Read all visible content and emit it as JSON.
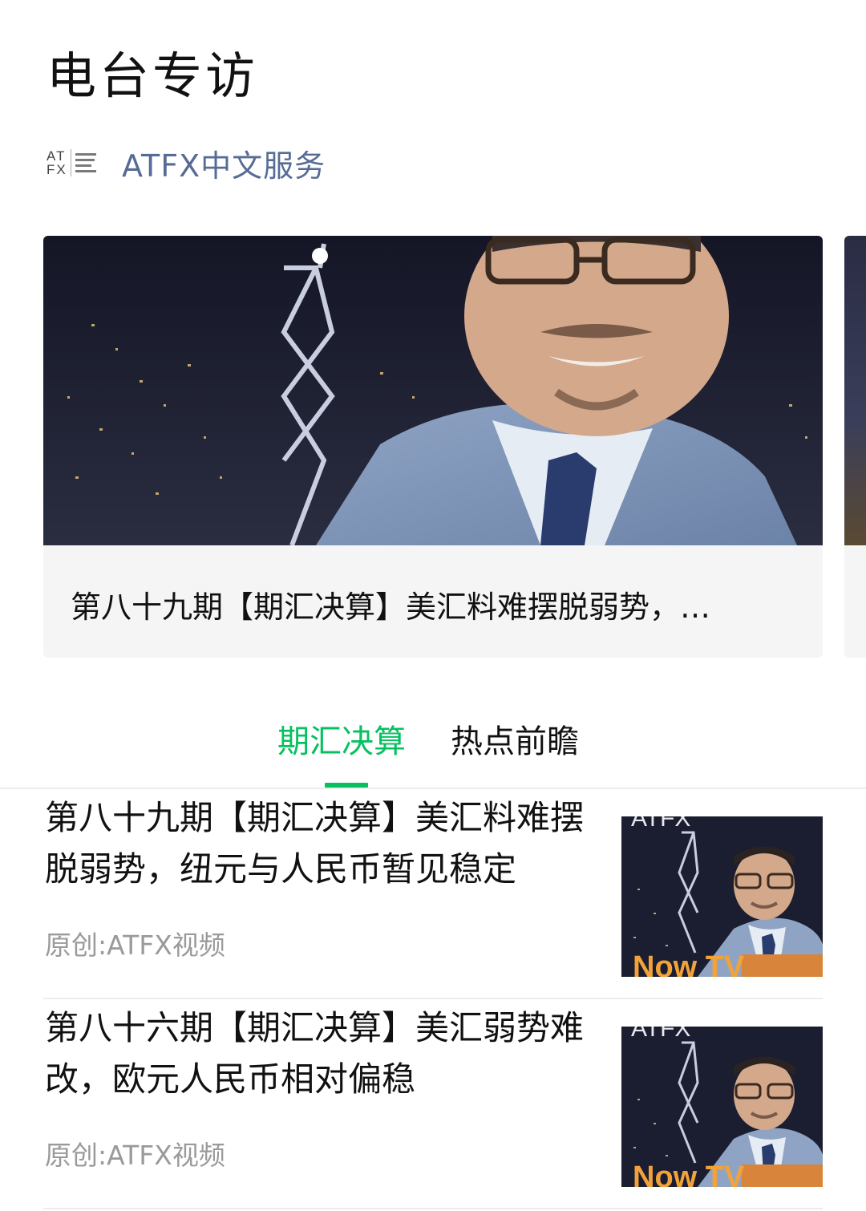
{
  "page": {
    "title": "电台专访"
  },
  "account": {
    "name": "ATFX中文服务",
    "logo_text_top": "AT",
    "logo_text_bottom": "FX"
  },
  "carousel": {
    "caption": "第八十九期【期汇决算】美汇料难摆脱弱势，…"
  },
  "tabs": [
    {
      "label": "期汇决算",
      "active": true
    },
    {
      "label": "热点前瞻",
      "active": false
    }
  ],
  "articles": [
    {
      "title": "第八十九期【期汇决算】美汇料难摆脱弱势，纽元与人民币暂见稳定",
      "source": "原创:ATFX视频",
      "thumb_badge": "Now TV",
      "thumb_top": "ATFX"
    },
    {
      "title": "第八十六期【期汇决算】美汇弱势难改，欧元人民币相对偏稳",
      "source": "原创:ATFX视频",
      "thumb_badge": "Now TV",
      "thumb_top": "ATFX"
    }
  ],
  "colors": {
    "accent": "#07c160",
    "account_link": "#576b95",
    "muted": "#9a9a9a"
  }
}
